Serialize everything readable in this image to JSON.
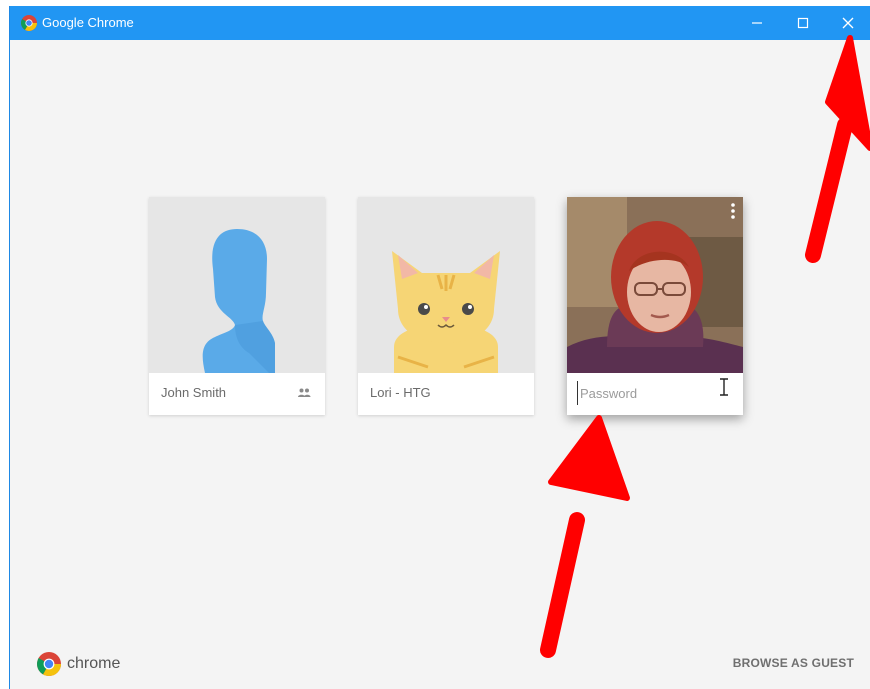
{
  "window": {
    "title": "Google Chrome"
  },
  "profiles": [
    {
      "name": "John Smith",
      "avatar": "silhouette-avatar",
      "badge": "supervised-users-icon"
    },
    {
      "name": "Lori - HTG",
      "avatar": "cat-avatar"
    },
    {
      "name": "",
      "avatar": "user-photo",
      "password_placeholder": "Password",
      "menu_icon": "kebab-menu-icon"
    }
  ],
  "footer": {
    "brand": "chrome",
    "guest_label": "BROWSE AS GUEST"
  },
  "colors": {
    "titlebar": "#2196f3",
    "background": "#f4f4f4",
    "arrow": "#ff0000",
    "avatar_blue": "#5aaae8",
    "cat_yellow": "#f6d575"
  }
}
